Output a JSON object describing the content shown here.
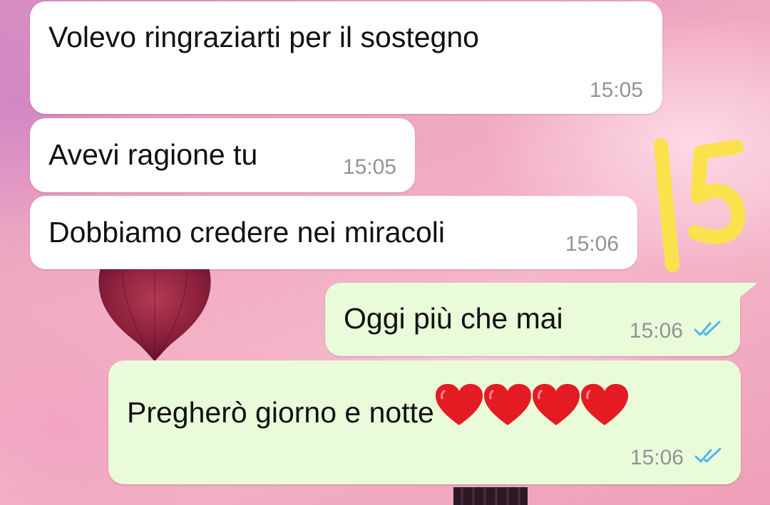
{
  "chat": {
    "messages": [
      {
        "text": "Volevo ringraziarti per il sostegno",
        "time": "15:05",
        "direction": "incoming"
      },
      {
        "text": "Avevi ragione tu",
        "time": "15:05",
        "direction": "incoming"
      },
      {
        "text": "Dobbiamo credere nei miracoli",
        "time": "15:06",
        "direction": "incoming"
      },
      {
        "text": "Oggi più che mai",
        "time": "15:06",
        "direction": "outgoing",
        "status": "read"
      },
      {
        "text": "Pregherò giorno e notte",
        "time": "15:06",
        "direction": "outgoing",
        "status": "read",
        "emoji": [
          "heart",
          "heart",
          "heart",
          "heart"
        ]
      }
    ]
  },
  "sticker": {
    "text": "15",
    "color": "#fae24c"
  },
  "colors": {
    "incoming_bubble": "#ffffff",
    "outgoing_bubble": "#e9fbd9",
    "read_ticks": "#4fb6ec",
    "timestamp": "#8f9498",
    "heart": "#e41b23"
  },
  "icons": {
    "read_receipt": "double-check-icon",
    "heart_emoji": "red-heart-icon"
  }
}
